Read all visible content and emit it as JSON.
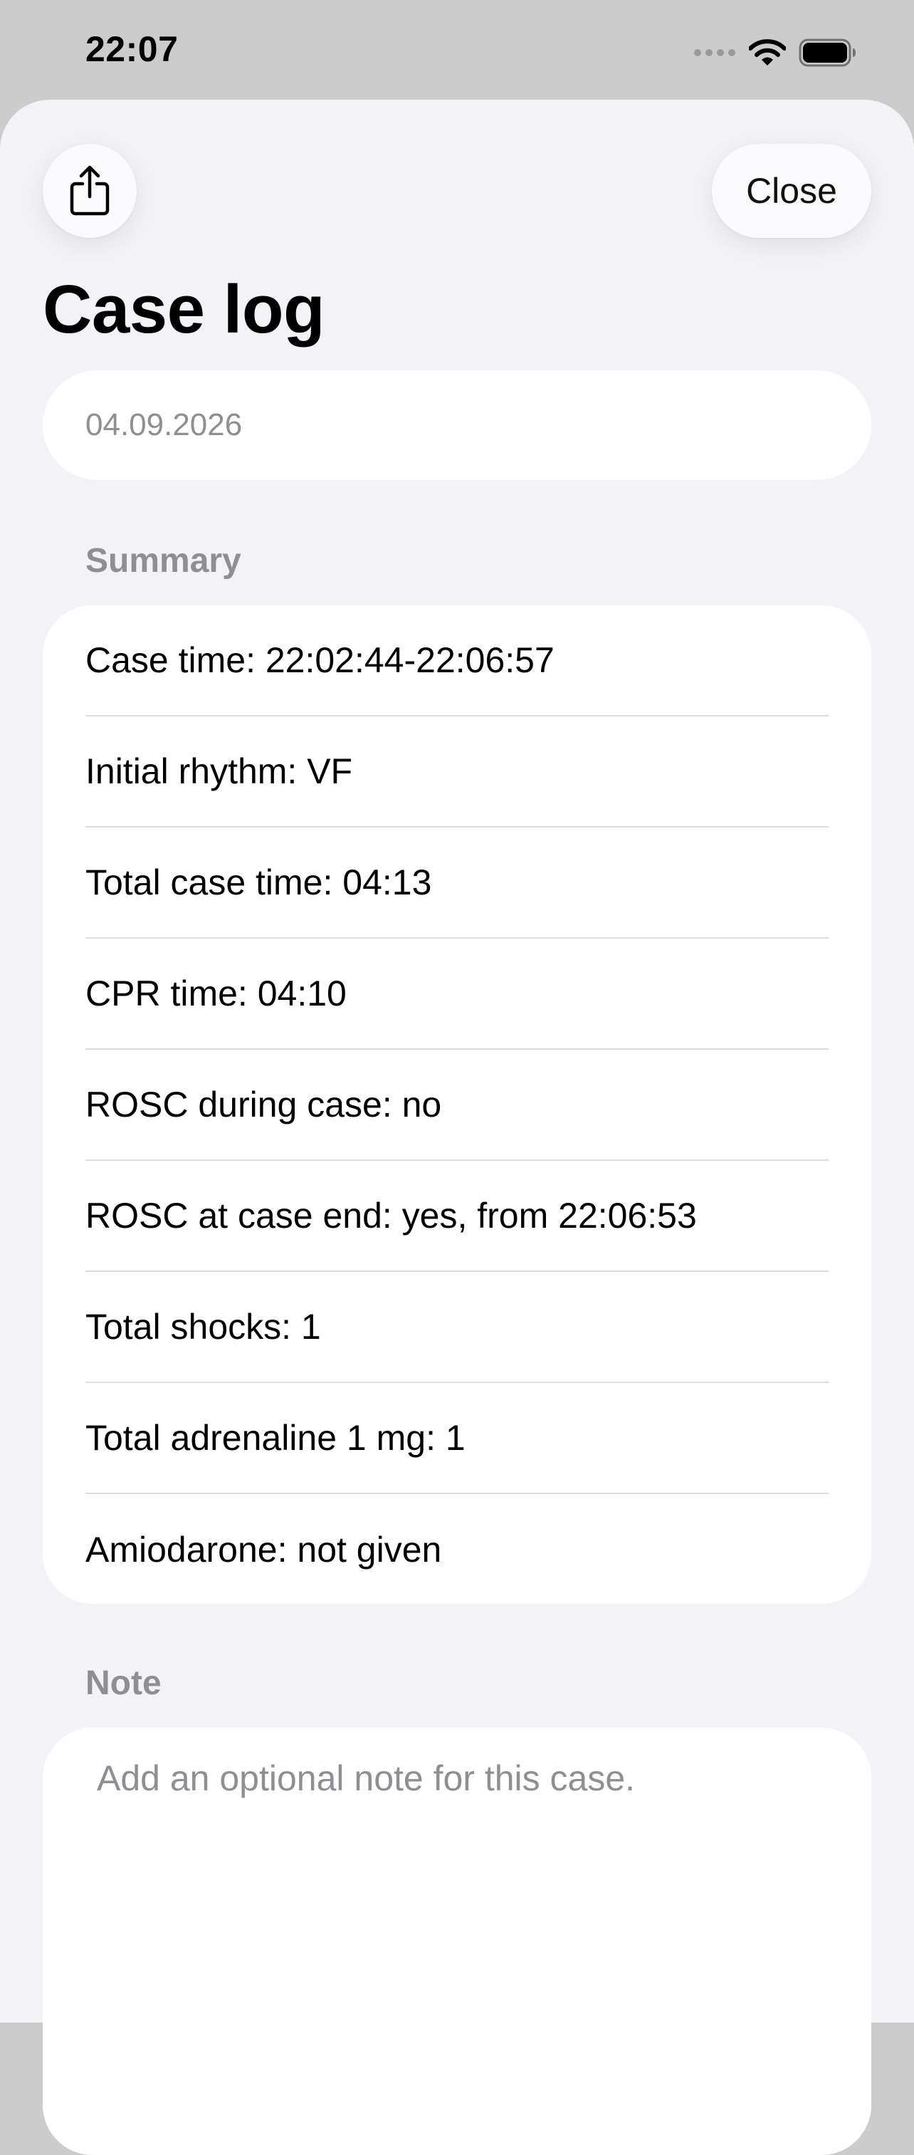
{
  "status_bar": {
    "time": "22:07",
    "icons": [
      "signal-dots-icon",
      "wifi-icon",
      "battery-icon"
    ]
  },
  "header": {
    "share_icon": "share-icon",
    "close_label": "Close",
    "title": "Case log"
  },
  "date_field": {
    "value": "04.09.2026"
  },
  "summary": {
    "header": "Summary",
    "rows": [
      "Case time: 22:02:44-22:06:57",
      "Initial rhythm: VF",
      "Total case time: 04:13",
      "CPR time: 04:10",
      "ROSC during case: no",
      "ROSC at case end: yes, from 22:06:53",
      "Total shocks: 1",
      "Total adrenaline 1 mg: 1",
      "Amiodarone: not given"
    ]
  },
  "note": {
    "header": "Note",
    "placeholder": "Add an optional note for this case."
  },
  "colors": {
    "sheet_background": "#f2f2f7",
    "card_background": "#ffffff",
    "secondary_text": "#8e8e93",
    "backdrop": "#cccccc"
  }
}
